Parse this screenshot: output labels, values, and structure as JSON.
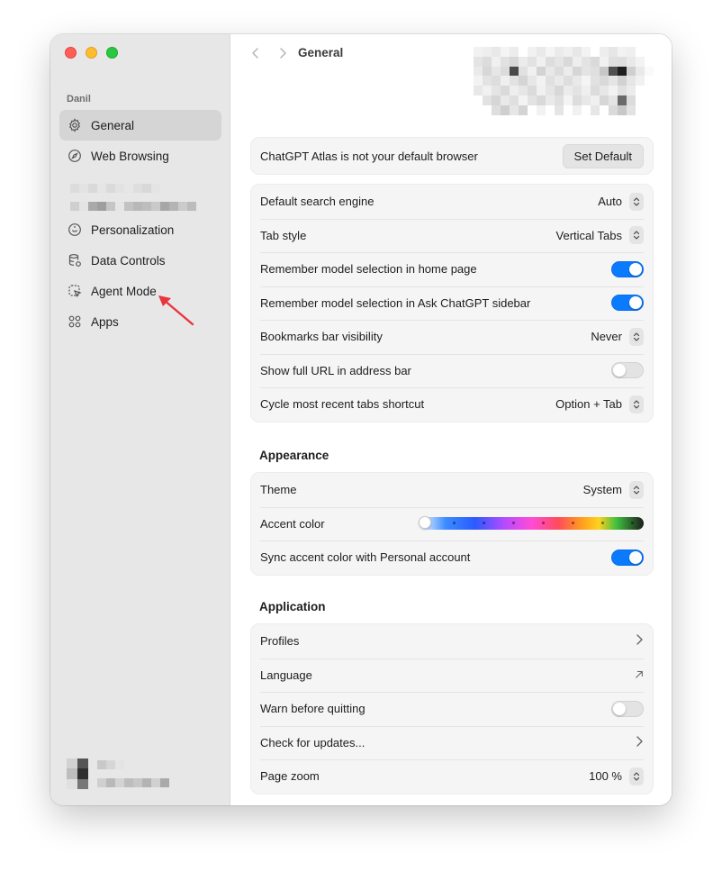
{
  "window": {
    "account_label": "Danil",
    "page_title": "General"
  },
  "sidebar": {
    "items": [
      {
        "label": "General",
        "icon": "gear-icon",
        "active": true
      },
      {
        "label": "Web Browsing",
        "icon": "compass-icon",
        "active": false
      },
      {
        "label": "Personalization",
        "icon": "personalization-icon",
        "active": false
      },
      {
        "label": "Data Controls",
        "icon": "database-icon",
        "active": false
      },
      {
        "label": "Agent Mode",
        "icon": "agent-cursor-icon",
        "active": false
      },
      {
        "label": "Apps",
        "icon": "apps-grid-icon",
        "active": false
      }
    ]
  },
  "default_browser": {
    "message": "ChatGPT Atlas is not your default browser",
    "button_label": "Set Default"
  },
  "general_settings": [
    {
      "label": "Default search engine",
      "value": "Auto",
      "control": "select"
    },
    {
      "label": "Tab style",
      "value": "Vertical Tabs",
      "control": "select"
    },
    {
      "label": "Remember model selection in home page",
      "control": "toggle",
      "on": true
    },
    {
      "label": "Remember model selection in Ask ChatGPT sidebar",
      "control": "toggle",
      "on": true
    },
    {
      "label": "Bookmarks bar visibility",
      "value": "Never",
      "control": "select"
    },
    {
      "label": "Show full URL in address bar",
      "control": "toggle",
      "on": false
    },
    {
      "label": "Cycle most recent tabs shortcut",
      "value": "Option + Tab",
      "control": "select"
    }
  ],
  "appearance": {
    "title": "Appearance",
    "theme_label": "Theme",
    "theme_value": "System",
    "accent_label": "Accent color",
    "sync_label": "Sync accent color with Personal account",
    "sync_on": true
  },
  "application": {
    "title": "Application",
    "profiles_label": "Profiles",
    "language_label": "Language",
    "warn_label": "Warn before quitting",
    "warn_on": false,
    "updates_label": "Check for updates...",
    "zoom_label": "Page zoom",
    "zoom_value": "100 %"
  },
  "colors": {
    "accent": "#0a7aff",
    "annotation_arrow": "#e8363f"
  }
}
